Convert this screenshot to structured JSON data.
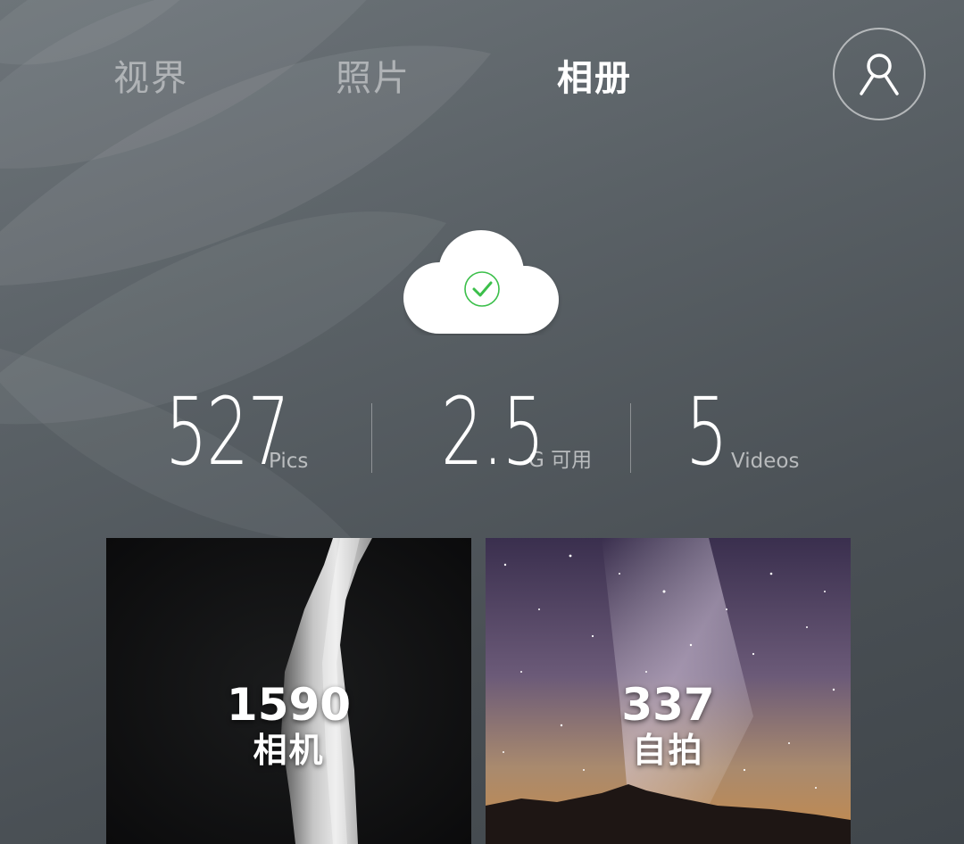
{
  "tabs": [
    {
      "label": "视界",
      "active": false
    },
    {
      "label": "照片",
      "active": false
    },
    {
      "label": "相册",
      "active": true
    }
  ],
  "profile": {
    "icon": "user-icon"
  },
  "sync": {
    "icon": "cloud-check-icon",
    "check_color": "#3bbf4a"
  },
  "stats": {
    "pics": {
      "value": "527",
      "unit": "Pics"
    },
    "space": {
      "value": "2.5",
      "unit": "G 可用"
    },
    "videos": {
      "value": "5",
      "unit": "Videos"
    }
  },
  "albums": [
    {
      "count": "1590",
      "name": "相机",
      "cover": "dark-fabric"
    },
    {
      "count": "337",
      "name": "自拍",
      "cover": "milky-way"
    }
  ],
  "colors": {
    "background": "#5a6166",
    "active_tab": "#ffffff",
    "inactive_tab": "rgba(255,255,255,0.45)"
  }
}
